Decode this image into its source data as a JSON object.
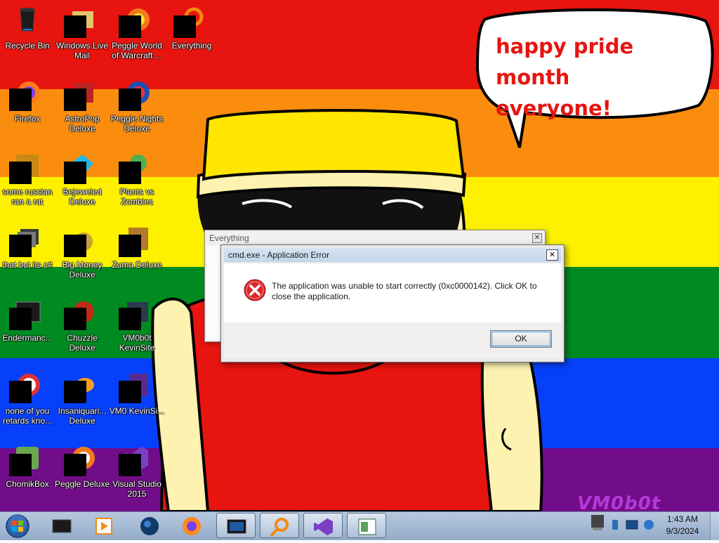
{
  "wallpaper": {
    "speech_bubble_lines": [
      "happy pride month",
      "everyone!"
    ],
    "watermark": "VM0b0t",
    "stripe_colors": [
      "#e8140f",
      "#fb8d0e",
      "#fdf100",
      "#008a22",
      "#0740fb",
      "#720d8a"
    ]
  },
  "desktop_icons": [
    {
      "label": "Recycle Bin",
      "icon": "recycle-bin-icon"
    },
    {
      "label": "Windows Live Mail",
      "icon": "mail-icon"
    },
    {
      "label": "Peggle World of Warcraft ...",
      "icon": "game-icon"
    },
    {
      "label": "Everything",
      "icon": "search-icon"
    },
    {
      "label": "Firefox",
      "icon": "firefox-icon"
    },
    {
      "label": "AstroPop Deluxe",
      "icon": "game-icon"
    },
    {
      "label": "Peggle Nights Deluxe",
      "icon": "game-icon"
    },
    {
      "label": "some russian ran a rat",
      "icon": "file-icon"
    },
    {
      "label": "Bejeweled Deluxe",
      "icon": "gem-icon"
    },
    {
      "label": "Plants vs Zombies",
      "icon": "plant-icon"
    },
    {
      "label": "that but its c#",
      "icon": "folder-icon"
    },
    {
      "label": "Big Money Deluxe",
      "icon": "money-bag-icon"
    },
    {
      "label": "Zuma Deluxe",
      "icon": "game-icon"
    },
    {
      "label": "Endermanc...",
      "icon": "terminal-icon"
    },
    {
      "label": "Chuzzle Deluxe",
      "icon": "game-icon"
    },
    {
      "label": "VM0b0t KevinSite",
      "icon": "file-icon"
    },
    {
      "label": "none of you retards kno...",
      "icon": "file-icon"
    },
    {
      "label": "Insaniquari... Deluxe",
      "icon": "fish-icon"
    },
    {
      "label": "VM0 KevinSi...",
      "icon": "file-icon"
    },
    {
      "label": "ChomikBox",
      "icon": "hamster-icon"
    },
    {
      "label": "Peggle Deluxe",
      "icon": "game-icon"
    },
    {
      "label": "Visual Studio 2015",
      "icon": "visual-studio-icon"
    }
  ],
  "everything_window": {
    "title": "Everything",
    "close_glyph": "✕"
  },
  "error_dialog": {
    "title": "cmd.exe - Application Error",
    "close_glyph": "✕",
    "message": "The application was unable to start correctly (0xc0000142). Click OK to close the application.",
    "ok_label": "OK"
  },
  "taskbar": {
    "pinned": [
      {
        "icon": "cmd-icon",
        "active": false
      },
      {
        "icon": "media-player-icon",
        "active": false
      },
      {
        "icon": "globe-icon",
        "active": false
      },
      {
        "icon": "firefox-icon",
        "active": false
      },
      {
        "icon": "monitor-icon",
        "active": true
      },
      {
        "icon": "everything-search-icon",
        "active": true
      },
      {
        "icon": "visual-studio-icon",
        "active": true
      },
      {
        "icon": "window-app-icon",
        "active": true
      }
    ],
    "clock": {
      "time": "1:43 AM",
      "date": "9/3/2024"
    }
  }
}
